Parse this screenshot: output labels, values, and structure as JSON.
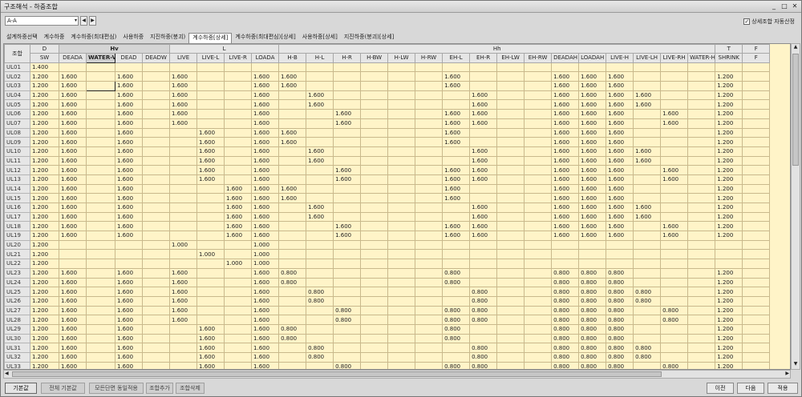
{
  "window": {
    "title": "구조해석 - 하중조합",
    "min": "_",
    "max": "□",
    "close": "✕"
  },
  "toolbar": {
    "combo_value": "A-A",
    "combo_arrow": "▾",
    "prev": "◀",
    "next": "▶",
    "auto_label": "상세조합 자동산정",
    "auto_checked": "✓"
  },
  "tabs": [
    {
      "label": "설계하중선택",
      "active": false
    },
    {
      "label": "계수하중",
      "active": false
    },
    {
      "label": "계수하중(최대편심)",
      "active": false
    },
    {
      "label": "사용하중",
      "active": false
    },
    {
      "label": "지진하중(붕괴)",
      "active": false
    },
    {
      "label": "계수하중[상세]",
      "active": true
    },
    {
      "label": "계수하중(최대편심)[상세]",
      "active": false
    },
    {
      "label": "사용하중[상세]",
      "active": false
    },
    {
      "label": "지진하중(붕괴)[상세]",
      "active": false
    }
  ],
  "grid": {
    "corner": "조합",
    "groups": [
      {
        "label": "D",
        "span": 1
      },
      {
        "label": "Hv",
        "span": 4
      },
      {
        "label": "L",
        "span": 4
      },
      {
        "label": "Hh",
        "span": 16
      },
      {
        "label": "T",
        "span": 1
      },
      {
        "label": "F",
        "span": 1
      }
    ],
    "columns": [
      "SW",
      "DEADA",
      "WATER-V",
      "DEAD",
      "DEADW",
      "LIVE",
      "LIVE-L",
      "LIVE-R",
      "LOADA",
      "H-B",
      "H-L",
      "H-R",
      "H-BW",
      "H-LW",
      "H-RW",
      "EH-L",
      "EH-R",
      "EH-LW",
      "EH-RW",
      "DEADAH",
      "LOADAH",
      "LIVE-H",
      "LIVE-LH",
      "LIVE-RH",
      "WATER-H",
      "SHRINK",
      "F"
    ],
    "rows": [
      [
        "UL01",
        "1.400",
        "",
        "",
        "",
        "",
        "",
        "",
        "",
        "",
        "",
        "",
        "",
        "",
        "",
        "",
        "",
        "",
        "",
        "",
        "",
        "",
        "",
        "",
        "",
        "",
        "",
        ""
      ],
      [
        "UL02",
        "1.200",
        "1.600",
        "",
        "1.600",
        "",
        "1.600",
        "",
        "",
        "1.600",
        "1.600",
        "",
        "",
        "",
        "",
        "",
        "1.600",
        "",
        "",
        "",
        "1.600",
        "1.600",
        "1.600",
        "",
        "",
        "",
        "1.200",
        ""
      ],
      [
        "UL03",
        "1.200",
        "1.600",
        "",
        "1.600",
        "",
        "1.600",
        "",
        "",
        "1.600",
        "1.600",
        "",
        "",
        "",
        "",
        "",
        "1.600",
        "",
        "",
        "",
        "1.600",
        "1.600",
        "1.600",
        "",
        "",
        "",
        "1.200",
        ""
      ],
      [
        "UL04",
        "1.200",
        "1.600",
        "",
        "1.600",
        "",
        "1.600",
        "",
        "",
        "1.600",
        "",
        "1.600",
        "",
        "",
        "",
        "",
        "",
        "1.600",
        "",
        "",
        "1.600",
        "1.600",
        "1.600",
        "1.600",
        "",
        "",
        "1.200",
        ""
      ],
      [
        "UL05",
        "1.200",
        "1.600",
        "",
        "1.600",
        "",
        "1.600",
        "",
        "",
        "1.600",
        "",
        "1.600",
        "",
        "",
        "",
        "",
        "",
        "1.600",
        "",
        "",
        "1.600",
        "1.600",
        "1.600",
        "1.600",
        "",
        "",
        "1.200",
        ""
      ],
      [
        "UL06",
        "1.200",
        "1.600",
        "",
        "1.600",
        "",
        "1.600",
        "",
        "",
        "1.600",
        "",
        "",
        "1.600",
        "",
        "",
        "",
        "1.600",
        "1.600",
        "",
        "",
        "1.600",
        "1.600",
        "1.600",
        "",
        "1.600",
        "",
        "1.200",
        ""
      ],
      [
        "UL07",
        "1.200",
        "1.600",
        "",
        "1.600",
        "",
        "1.600",
        "",
        "",
        "1.600",
        "",
        "",
        "1.600",
        "",
        "",
        "",
        "1.600",
        "1.600",
        "",
        "",
        "1.600",
        "1.600",
        "1.600",
        "",
        "1.600",
        "",
        "1.200",
        ""
      ],
      [
        "UL08",
        "1.200",
        "1.600",
        "",
        "1.600",
        "",
        "",
        "1.600",
        "",
        "1.600",
        "1.600",
        "",
        "",
        "",
        "",
        "",
        "1.600",
        "",
        "",
        "",
        "1.600",
        "1.600",
        "1.600",
        "",
        "",
        "",
        "1.200",
        ""
      ],
      [
        "UL09",
        "1.200",
        "1.600",
        "",
        "1.600",
        "",
        "",
        "1.600",
        "",
        "1.600",
        "1.600",
        "",
        "",
        "",
        "",
        "",
        "1.600",
        "",
        "",
        "",
        "1.600",
        "1.600",
        "1.600",
        "",
        "",
        "",
        "1.200",
        ""
      ],
      [
        "UL10",
        "1.200",
        "1.600",
        "",
        "1.600",
        "",
        "",
        "1.600",
        "",
        "1.600",
        "",
        "1.600",
        "",
        "",
        "",
        "",
        "",
        "1.600",
        "",
        "",
        "1.600",
        "1.600",
        "1.600",
        "1.600",
        "",
        "",
        "1.200",
        ""
      ],
      [
        "UL11",
        "1.200",
        "1.600",
        "",
        "1.600",
        "",
        "",
        "1.600",
        "",
        "1.600",
        "",
        "1.600",
        "",
        "",
        "",
        "",
        "",
        "1.600",
        "",
        "",
        "1.600",
        "1.600",
        "1.600",
        "1.600",
        "",
        "",
        "1.200",
        ""
      ],
      [
        "UL12",
        "1.200",
        "1.600",
        "",
        "1.600",
        "",
        "",
        "1.600",
        "",
        "1.600",
        "",
        "",
        "1.600",
        "",
        "",
        "",
        "1.600",
        "1.600",
        "",
        "",
        "1.600",
        "1.600",
        "1.600",
        "",
        "1.600",
        "",
        "1.200",
        ""
      ],
      [
        "UL13",
        "1.200",
        "1.600",
        "",
        "1.600",
        "",
        "",
        "1.600",
        "",
        "1.600",
        "",
        "",
        "1.600",
        "",
        "",
        "",
        "1.600",
        "1.600",
        "",
        "",
        "1.600",
        "1.600",
        "1.600",
        "",
        "1.600",
        "",
        "1.200",
        ""
      ],
      [
        "UL14",
        "1.200",
        "1.600",
        "",
        "1.600",
        "",
        "",
        "",
        "1.600",
        "1.600",
        "1.600",
        "",
        "",
        "",
        "",
        "",
        "1.600",
        "",
        "",
        "",
        "1.600",
        "1.600",
        "1.600",
        "",
        "",
        "",
        "1.200",
        ""
      ],
      [
        "UL15",
        "1.200",
        "1.600",
        "",
        "1.600",
        "",
        "",
        "",
        "1.600",
        "1.600",
        "1.600",
        "",
        "",
        "",
        "",
        "",
        "1.600",
        "",
        "",
        "",
        "1.600",
        "1.600",
        "1.600",
        "",
        "",
        "",
        "1.200",
        ""
      ],
      [
        "UL16",
        "1.200",
        "1.600",
        "",
        "1.600",
        "",
        "",
        "",
        "1.600",
        "1.600",
        "",
        "1.600",
        "",
        "",
        "",
        "",
        "",
        "1.600",
        "",
        "",
        "1.600",
        "1.600",
        "1.600",
        "1.600",
        "",
        "",
        "1.200",
        ""
      ],
      [
        "UL17",
        "1.200",
        "1.600",
        "",
        "1.600",
        "",
        "",
        "",
        "1.600",
        "1.600",
        "",
        "1.600",
        "",
        "",
        "",
        "",
        "",
        "1.600",
        "",
        "",
        "1.600",
        "1.600",
        "1.600",
        "1.600",
        "",
        "",
        "1.200",
        ""
      ],
      [
        "UL18",
        "1.200",
        "1.600",
        "",
        "1.600",
        "",
        "",
        "",
        "1.600",
        "1.600",
        "",
        "",
        "1.600",
        "",
        "",
        "",
        "1.600",
        "1.600",
        "",
        "",
        "1.600",
        "1.600",
        "1.600",
        "",
        "1.600",
        "",
        "1.200",
        ""
      ],
      [
        "UL19",
        "1.200",
        "1.600",
        "",
        "1.600",
        "",
        "",
        "",
        "1.600",
        "1.600",
        "",
        "",
        "1.600",
        "",
        "",
        "",
        "1.600",
        "1.600",
        "",
        "",
        "1.600",
        "1.600",
        "1.600",
        "",
        "1.600",
        "",
        "1.200",
        ""
      ],
      [
        "UL20",
        "1.200",
        "",
        "",
        "",
        "",
        "1.000",
        "",
        "",
        "1.000",
        "",
        "",
        "",
        "",
        "",
        "",
        "",
        "",
        "",
        "",
        "",
        "",
        "",
        "",
        "",
        "",
        "",
        ""
      ],
      [
        "UL21",
        "1.200",
        "",
        "",
        "",
        "",
        "",
        "1.000",
        "",
        "1.000",
        "",
        "",
        "",
        "",
        "",
        "",
        "",
        "",
        "",
        "",
        "",
        "",
        "",
        "",
        "",
        "",
        "",
        ""
      ],
      [
        "UL22",
        "1.200",
        "",
        "",
        "",
        "",
        "",
        "",
        "1.000",
        "1.000",
        "",
        "",
        "",
        "",
        "",
        "",
        "",
        "",
        "",
        "",
        "",
        "",
        "",
        "",
        "",
        "",
        "",
        ""
      ],
      [
        "UL23",
        "1.200",
        "1.600",
        "",
        "1.600",
        "",
        "1.600",
        "",
        "",
        "1.600",
        "0.800",
        "",
        "",
        "",
        "",
        "",
        "0.800",
        "",
        "",
        "",
        "0.800",
        "0.800",
        "0.800",
        "",
        "",
        "",
        "1.200",
        ""
      ],
      [
        "UL24",
        "1.200",
        "1.600",
        "",
        "1.600",
        "",
        "1.600",
        "",
        "",
        "1.600",
        "0.800",
        "",
        "",
        "",
        "",
        "",
        "0.800",
        "",
        "",
        "",
        "0.800",
        "0.800",
        "0.800",
        "",
        "",
        "",
        "1.200",
        ""
      ],
      [
        "UL25",
        "1.200",
        "1.600",
        "",
        "1.600",
        "",
        "1.600",
        "",
        "",
        "1.600",
        "",
        "0.800",
        "",
        "",
        "",
        "",
        "",
        "0.800",
        "",
        "",
        "0.800",
        "0.800",
        "0.800",
        "0.800",
        "",
        "",
        "1.200",
        ""
      ],
      [
        "UL26",
        "1.200",
        "1.600",
        "",
        "1.600",
        "",
        "1.600",
        "",
        "",
        "1.600",
        "",
        "0.800",
        "",
        "",
        "",
        "",
        "",
        "0.800",
        "",
        "",
        "0.800",
        "0.800",
        "0.800",
        "0.800",
        "",
        "",
        "1.200",
        ""
      ],
      [
        "UL27",
        "1.200",
        "1.600",
        "",
        "1.600",
        "",
        "1.600",
        "",
        "",
        "1.600",
        "",
        "",
        "0.800",
        "",
        "",
        "",
        "0.800",
        "0.800",
        "",
        "",
        "0.800",
        "0.800",
        "0.800",
        "",
        "0.800",
        "",
        "1.200",
        ""
      ],
      [
        "UL28",
        "1.200",
        "1.600",
        "",
        "1.600",
        "",
        "1.600",
        "",
        "",
        "1.600",
        "",
        "",
        "0.800",
        "",
        "",
        "",
        "0.800",
        "0.800",
        "",
        "",
        "0.800",
        "0.800",
        "0.800",
        "",
        "0.800",
        "",
        "1.200",
        ""
      ],
      [
        "UL29",
        "1.200",
        "1.600",
        "",
        "1.600",
        "",
        "",
        "1.600",
        "",
        "1.600",
        "0.800",
        "",
        "",
        "",
        "",
        "",
        "0.800",
        "",
        "",
        "",
        "0.800",
        "0.800",
        "0.800",
        "",
        "",
        "",
        "1.200",
        ""
      ],
      [
        "UL30",
        "1.200",
        "1.600",
        "",
        "1.600",
        "",
        "",
        "1.600",
        "",
        "1.600",
        "0.800",
        "",
        "",
        "",
        "",
        "",
        "0.800",
        "",
        "",
        "",
        "0.800",
        "0.800",
        "0.800",
        "",
        "",
        "",
        "1.200",
        ""
      ],
      [
        "UL31",
        "1.200",
        "1.600",
        "",
        "1.600",
        "",
        "",
        "1.600",
        "",
        "1.600",
        "",
        "0.800",
        "",
        "",
        "",
        "",
        "",
        "0.800",
        "",
        "",
        "0.800",
        "0.800",
        "0.800",
        "0.800",
        "",
        "",
        "1.200",
        ""
      ],
      [
        "UL32",
        "1.200",
        "1.600",
        "",
        "1.600",
        "",
        "",
        "1.600",
        "",
        "1.600",
        "",
        "0.800",
        "",
        "",
        "",
        "",
        "",
        "0.800",
        "",
        "",
        "0.800",
        "0.800",
        "0.800",
        "0.800",
        "",
        "",
        "1.200",
        ""
      ],
      [
        "UL33",
        "1.200",
        "1.600",
        "",
        "1.600",
        "",
        "",
        "1.600",
        "",
        "1.600",
        "",
        "",
        "0.800",
        "",
        "",
        "",
        "0.800",
        "0.800",
        "",
        "",
        "0.800",
        "0.800",
        "0.800",
        "",
        "0.800",
        "",
        "1.200",
        ""
      ]
    ]
  },
  "bottom": {
    "default_btn": "기본값",
    "all_default_btn": "전체 기본값",
    "apply_all_btn": "모든단면 동일적용",
    "add_btn": "조합추가",
    "delete_btn": "조합삭제",
    "prev_btn": "이전",
    "next_btn": "다음",
    "apply_btn": "적용"
  }
}
